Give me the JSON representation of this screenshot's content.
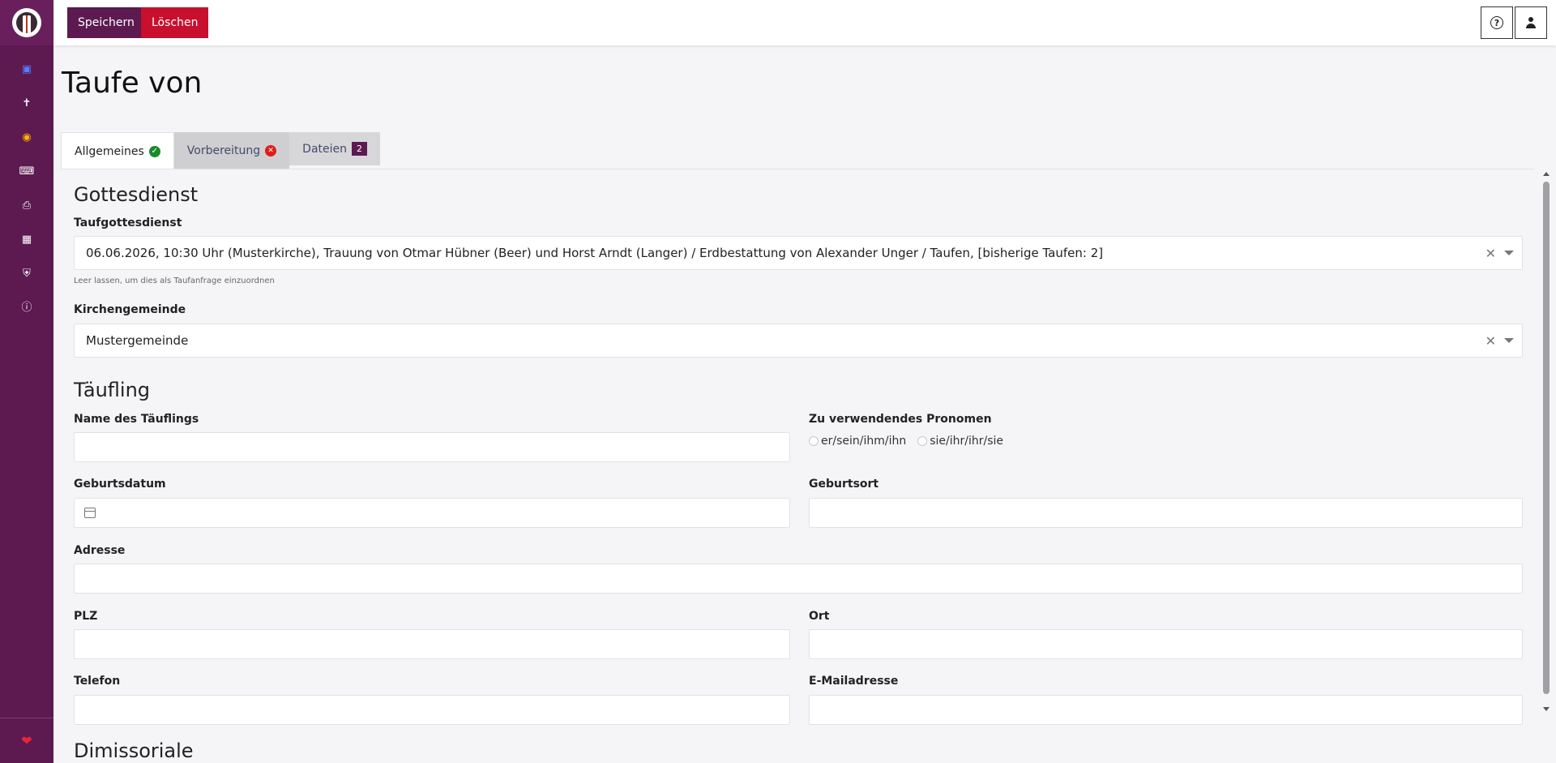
{
  "app": {
    "title": "Taufe von"
  },
  "sidebar": {
    "items": [
      {
        "icon": "calendar-icon"
      },
      {
        "icon": "cross-icon"
      },
      {
        "icon": "globe-icon"
      },
      {
        "icon": "keyboard-icon"
      },
      {
        "icon": "printer-icon"
      },
      {
        "icon": "calendar-check-icon"
      },
      {
        "icon": "user-shield-icon"
      },
      {
        "icon": "info-icon"
      }
    ],
    "bottom_icon": "heart-icon"
  },
  "toolbar": {
    "save_label": "Speichern",
    "delete_label": "Löschen"
  },
  "tabs": [
    {
      "label": "Allgemeines",
      "status": "ok"
    },
    {
      "label": "Vorbereitung",
      "status": "error"
    },
    {
      "label": "Dateien",
      "badge": "2"
    }
  ],
  "form": {
    "section_gottesdienst": "Gottesdienst",
    "taufgottesdienst_label": "Taufgottesdienst",
    "taufgottesdienst_value": "06.06.2026, 10:30 Uhr (Musterkirche), Trauung von Otmar Hübner (Beer) und Horst Arndt (Langer) / Erdbestattung von Alexander Unger / Taufen, [bisherige Taufen: 2]",
    "taufgottesdienst_hint": "Leer lassen, um dies als Taufanfrage einzuordnen",
    "kirchengemeinde_label": "Kirchengemeinde",
    "kirchengemeinde_value": "Mustergemeinde",
    "section_taeufling": "Täufling",
    "name_label": "Name des Täuflings",
    "pronomen_label": "Zu verwendendes Pronomen",
    "pronomen_options": [
      "er/sein/ihm/ihn",
      "sie/ihr/ihr/sie"
    ],
    "geburtsdatum_label": "Geburtsdatum",
    "geburtsort_label": "Geburtsort",
    "adresse_label": "Adresse",
    "plz_label": "PLZ",
    "ort_label": "Ort",
    "telefon_label": "Telefon",
    "email_label": "E-Mailadresse",
    "section_dimissoriale": "Dimissoriale"
  },
  "colors": {
    "brand": "#5c1a50",
    "danger": "#c8102e",
    "success": "#1a8a2a"
  }
}
